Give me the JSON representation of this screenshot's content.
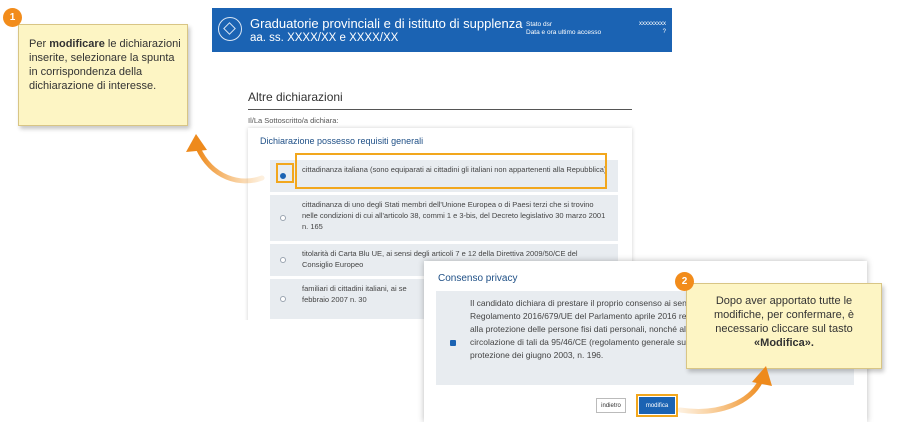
{
  "header": {
    "title": "Graduatorie provinciali e di istituto di supplenza",
    "subtitle": "aa. ss.  XXXX/XX   e  XXXX/XX",
    "status_label": "Stato dsr",
    "last_access_label": "Data e ora ultimo accesso",
    "user_info": "xxxxxxxxx",
    "user_info_2": "?"
  },
  "section": {
    "title": "Altre dichiarazioni",
    "subtitle": "Il/La Sottoscritto/a dichiara:"
  },
  "card": {
    "title": "Dichiarazione possesso requisiti generali",
    "options": [
      {
        "label": "cittadinanza italiana (sono equiparati ai cittadini gli italiani non appartenenti alla Repubblica)",
        "selected": true
      },
      {
        "label": "cittadinanza di uno degli Stati membri dell'Unione Europea o di Paesi terzi che si trovino nelle condizioni di cui all'articolo 38, commi 1 e 3-bis, del Decreto legislativo 30 marzo 2001 n. 165",
        "selected": false
      },
      {
        "label": "titolarità di Carta Blu UE, ai sensi degli articoli 7 e 12 della Direttiva 2009/50/CE del Consiglio Europeo",
        "selected": false
      },
      {
        "label": "familiari di cittadini italiani, ai se",
        "label_2": "febbraio 2007 n. 30",
        "selected": false
      }
    ]
  },
  "privacy": {
    "title": "Consenso privacy",
    "text": "Il candidato dichiara di prestare il proprio consenso ai sensi del Regolamento 2016/679/UE del Parlamento aprile 2016 relativo alla protezione delle persone fisi dati personali, nonché alla libera circolazione di tali da 95/46/CE (regolamento generale sulla protezione dei giugno 2003, n. 196.",
    "checked": true,
    "back_label": "indietro",
    "modify_label": "modifica"
  },
  "annotations": {
    "step1_number": "1",
    "step1_pre": "Per ",
    "step1_bold": "modificare",
    "step1_post": " le dichiarazioni inserite, selezionare la  spunta in corrispondenza della dichiarazione di interesse.",
    "step2_number": "2",
    "step2_text": "Dopo aver apportato tutte le modifiche, per confermare, è necessario cliccare sul tasto",
    "step2_bold": "«Modifica».",
    "highlight_color": "#f2a71d",
    "badge_color": "#f28c1b",
    "note_color": "#fdf5c4"
  },
  "colors": {
    "header_blue": "#1b63b3",
    "title_blue": "#1e4f86",
    "option_bg": "#e8ecf0"
  }
}
